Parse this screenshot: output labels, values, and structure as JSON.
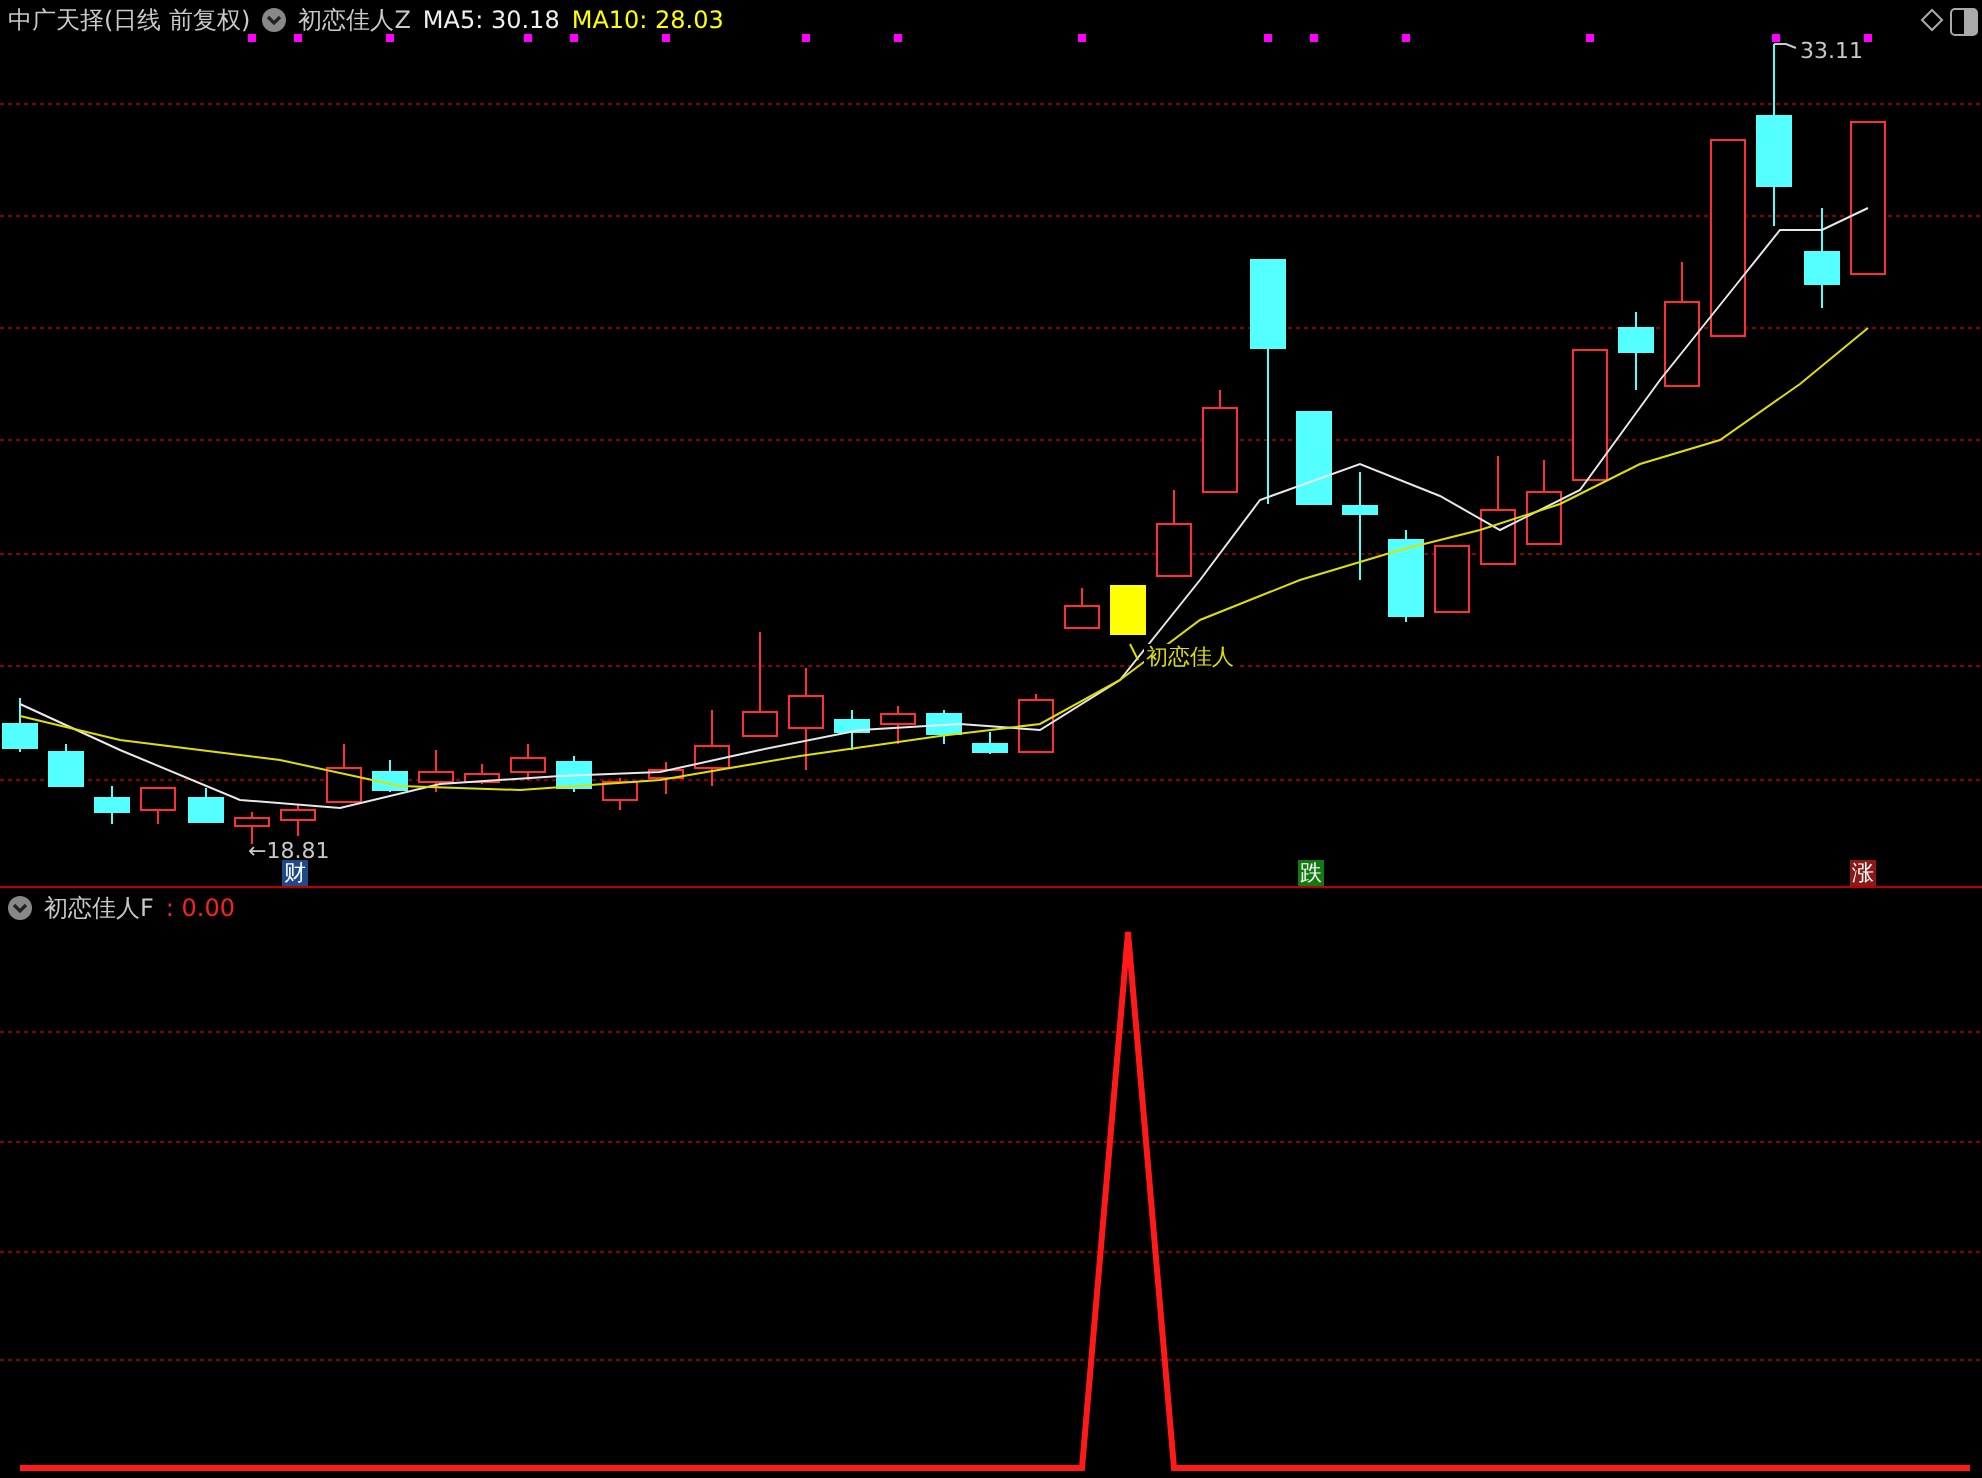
{
  "main_panel": {
    "title": "中广天择(日线 前复权)",
    "indicator": "初恋佳人Z",
    "ma5": "MA5: 30.18",
    "ma10": "MA10: 28.03",
    "low_label": "←18.81",
    "high_label": "33.11",
    "signal_label": "初恋佳人",
    "markers": [
      {
        "text": "财",
        "color": "#1f4a8a"
      },
      {
        "text": "跌",
        "color": "#127a12"
      },
      {
        "text": "涨",
        "color": "#8a1a1a"
      }
    ]
  },
  "sub_panel": {
    "indicator": "初恋佳人F",
    "value": ": 0.00"
  }
}
